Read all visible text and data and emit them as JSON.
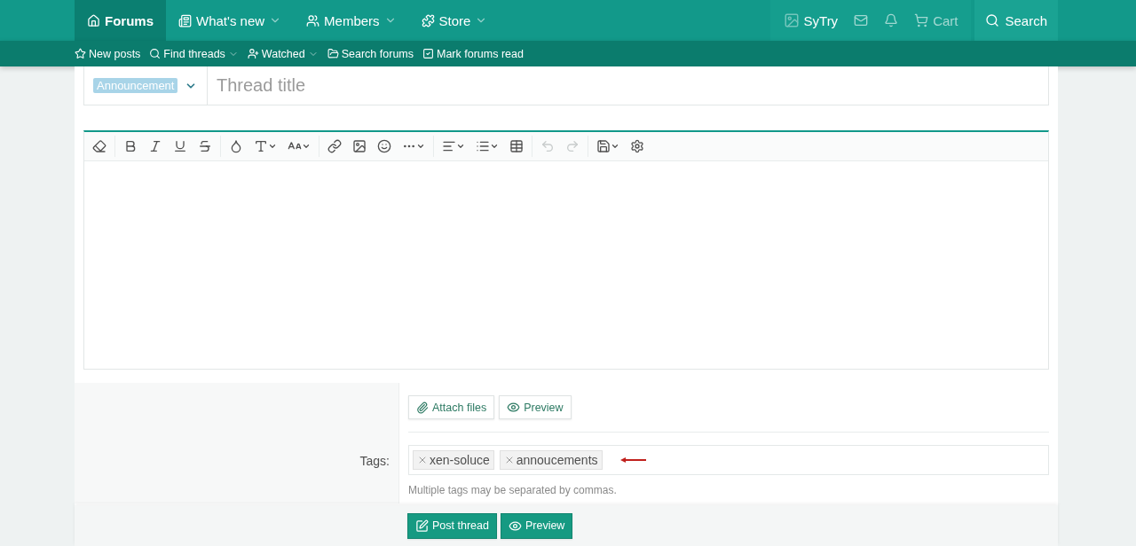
{
  "nav": {
    "items": [
      {
        "label": "Forums",
        "selected": true,
        "dropdown": false
      },
      {
        "label": "What's new",
        "selected": false,
        "dropdown": true
      },
      {
        "label": "Members",
        "selected": false,
        "dropdown": true
      },
      {
        "label": "Store",
        "selected": false,
        "dropdown": true
      }
    ],
    "user": "SyTry",
    "cart": "Cart",
    "search": "Search"
  },
  "subnav": [
    {
      "label": "New posts",
      "dropdown": false
    },
    {
      "label": "Find threads",
      "dropdown": true
    },
    {
      "label": "Watched",
      "dropdown": true
    },
    {
      "label": "Search forums",
      "dropdown": false
    },
    {
      "label": "Mark forums read",
      "dropdown": false
    }
  ],
  "thread": {
    "prefix": "Announcement",
    "title_placeholder": "Thread title"
  },
  "toolbar": [
    [
      {
        "dropdown": false,
        "disabled": false
      }
    ],
    [
      {
        "dropdown": false,
        "disabled": false
      },
      {
        "dropdown": false,
        "disabled": false
      },
      {
        "dropdown": false,
        "disabled": false
      },
      {
        "dropdown": false,
        "disabled": false
      }
    ],
    [
      {
        "dropdown": false,
        "disabled": false
      },
      {
        "dropdown": true,
        "disabled": false
      },
      {
        "dropdown": true,
        "disabled": false
      }
    ],
    [
      {
        "dropdown": false,
        "disabled": false
      },
      {
        "dropdown": false,
        "disabled": false
      },
      {
        "dropdown": false,
        "disabled": false
      },
      {
        "dropdown": true,
        "disabled": false
      }
    ],
    [
      {
        "dropdown": true,
        "disabled": false
      },
      {
        "dropdown": true,
        "disabled": false
      },
      {
        "dropdown": false,
        "disabled": false
      }
    ],
    [
      {
        "dropdown": false,
        "disabled": true
      },
      {
        "dropdown": false,
        "disabled": true
      }
    ],
    [
      {
        "dropdown": true,
        "disabled": false
      },
      {
        "dropdown": false,
        "disabled": false
      }
    ]
  ],
  "attach_buttons": [
    "Attach files",
    "Preview"
  ],
  "tags": {
    "label": "Tags:",
    "values": [
      "xen-soluce",
      "annoucements"
    ],
    "hint": "Multiple tags may be separated by commas."
  },
  "actions": [
    "Post thread",
    "Preview"
  ]
}
